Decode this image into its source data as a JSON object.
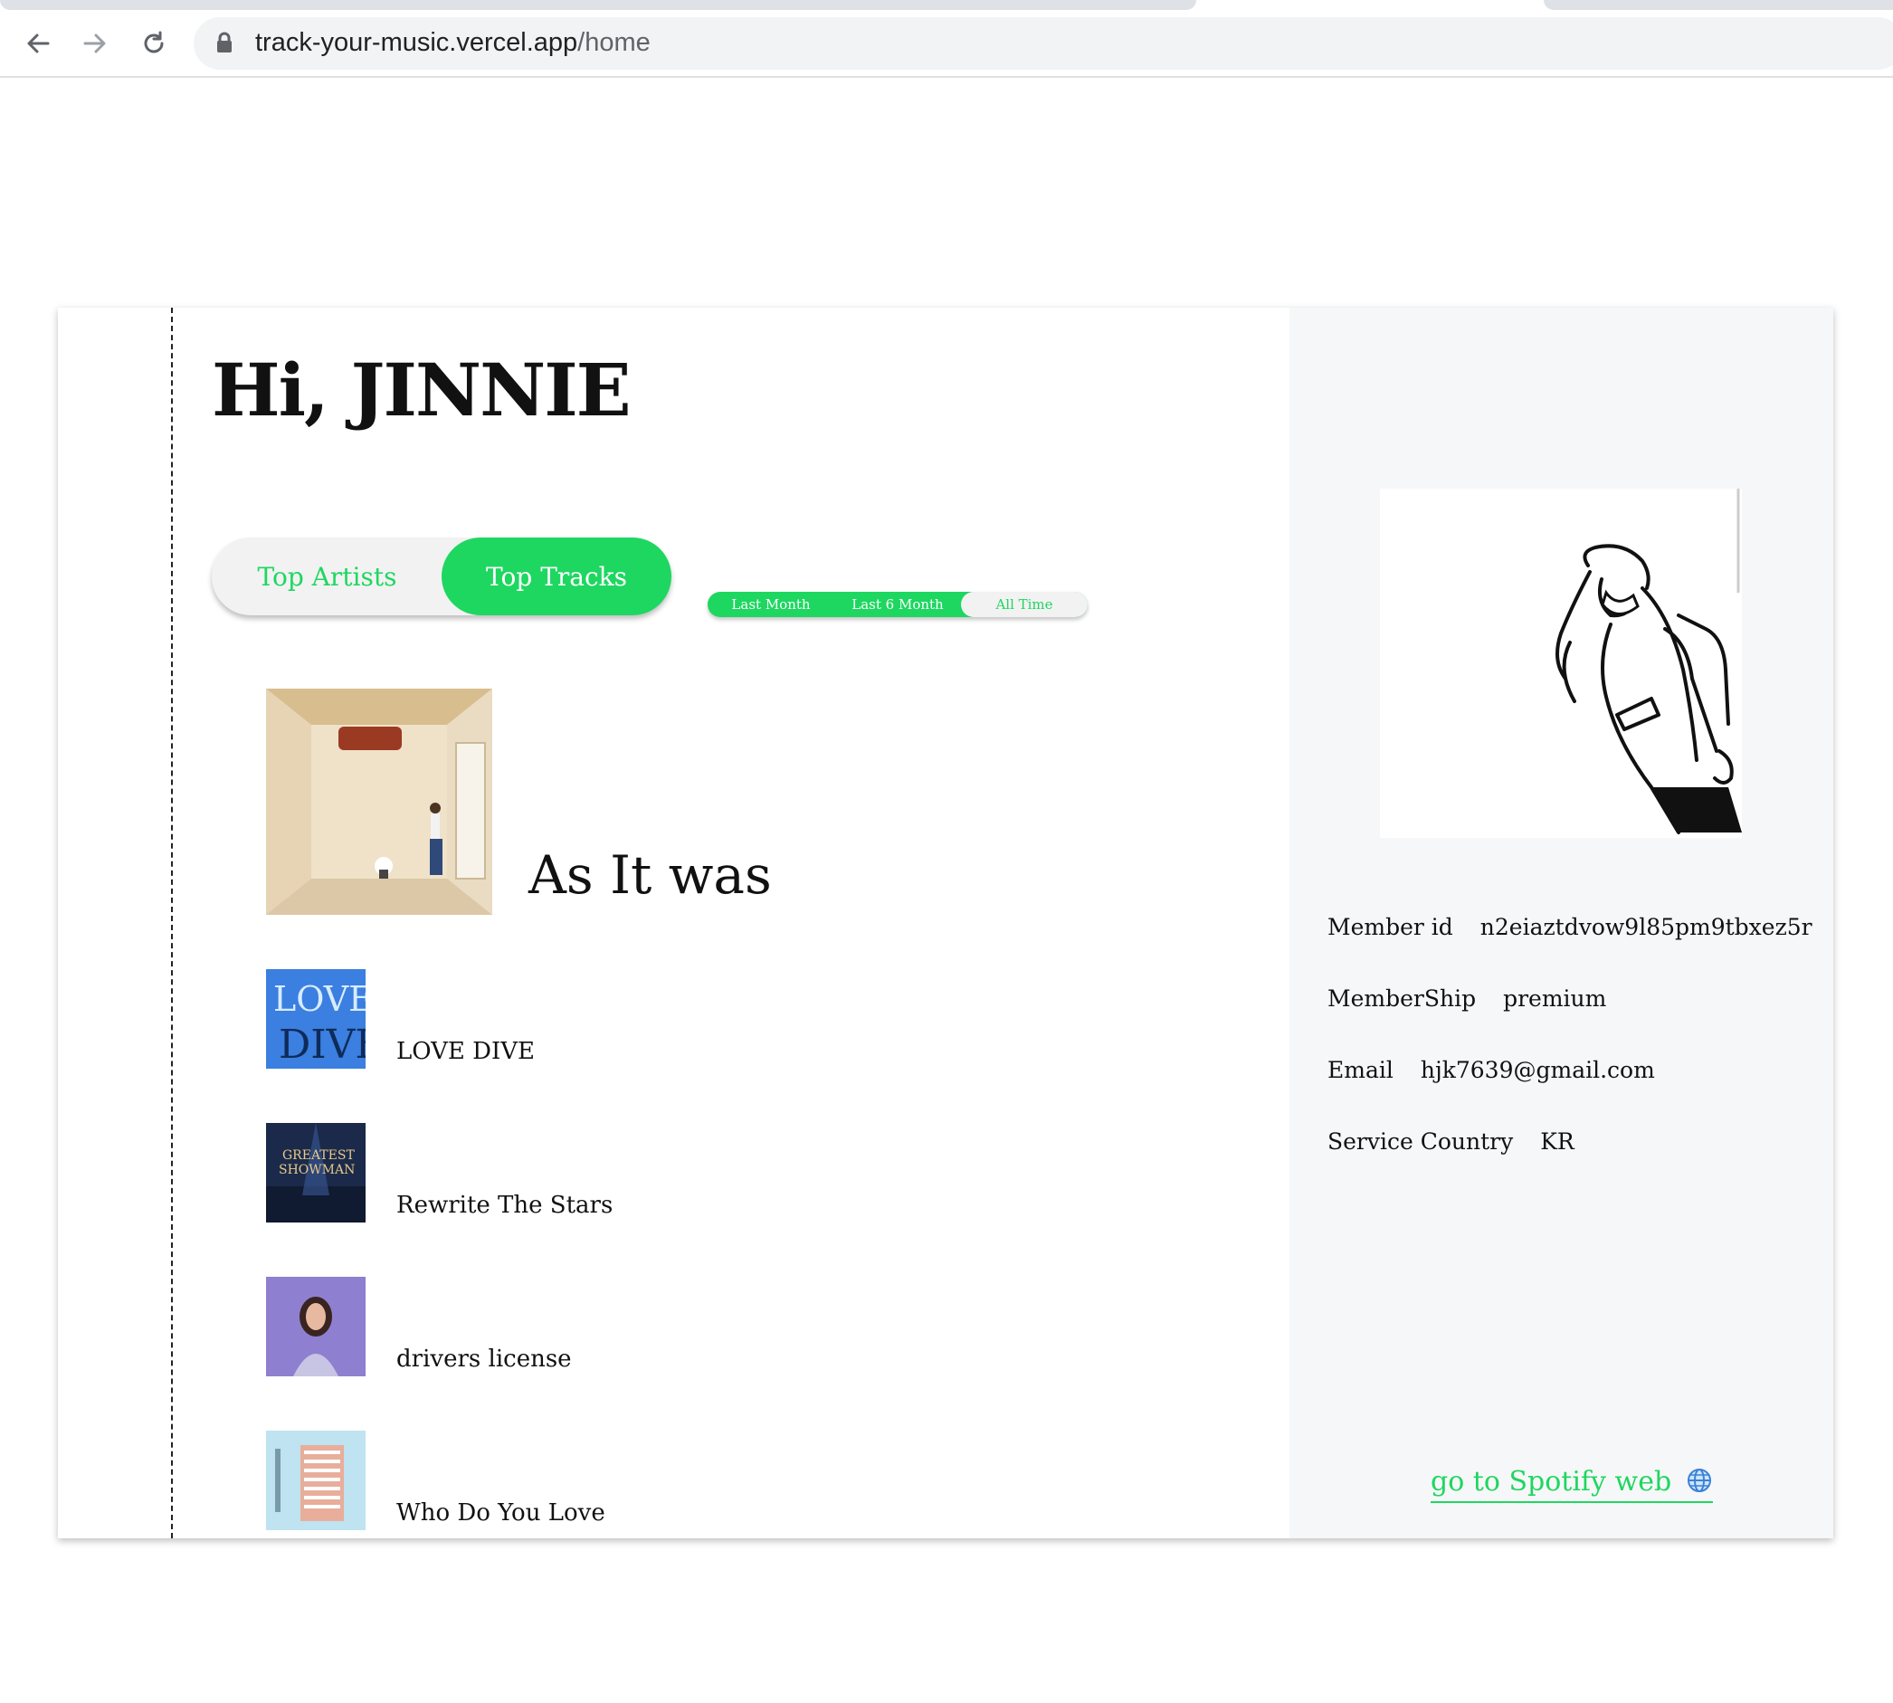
{
  "browser": {
    "url_host": "track-your-music.vercel.app",
    "url_path": "/home"
  },
  "page": {
    "greeting": "Hi, JINNIE",
    "tabs": [
      {
        "label": "Top Artists",
        "active": false
      },
      {
        "label": "Top Tracks",
        "active": true
      }
    ],
    "time_ranges": [
      {
        "label": "Last Month",
        "active": false
      },
      {
        "label": "Last 6 Month",
        "active": false
      },
      {
        "label": "All Time",
        "active": true
      }
    ],
    "tracks": [
      {
        "title": "As It was"
      },
      {
        "title": "LOVE DIVE"
      },
      {
        "title": "Rewrite The Stars"
      },
      {
        "title": "drivers license"
      },
      {
        "title": "Who Do You Love"
      }
    ]
  },
  "profile": {
    "fields": [
      {
        "label": "Member id",
        "value": "n2eiaztdvow9l85pm9tbxez5r"
      },
      {
        "label": "MemberShip",
        "value": "premium"
      },
      {
        "label": "Email",
        "value": "hjk7639@gmail.com"
      },
      {
        "label": "Service Country",
        "value": "KR"
      }
    ],
    "spotify_link": "go to Spotify web",
    "spotify_link_icon": "globe-icon"
  },
  "colors": {
    "accent": "#1ed760",
    "panel_bg": "#f6f7f8",
    "text": "#111111"
  }
}
